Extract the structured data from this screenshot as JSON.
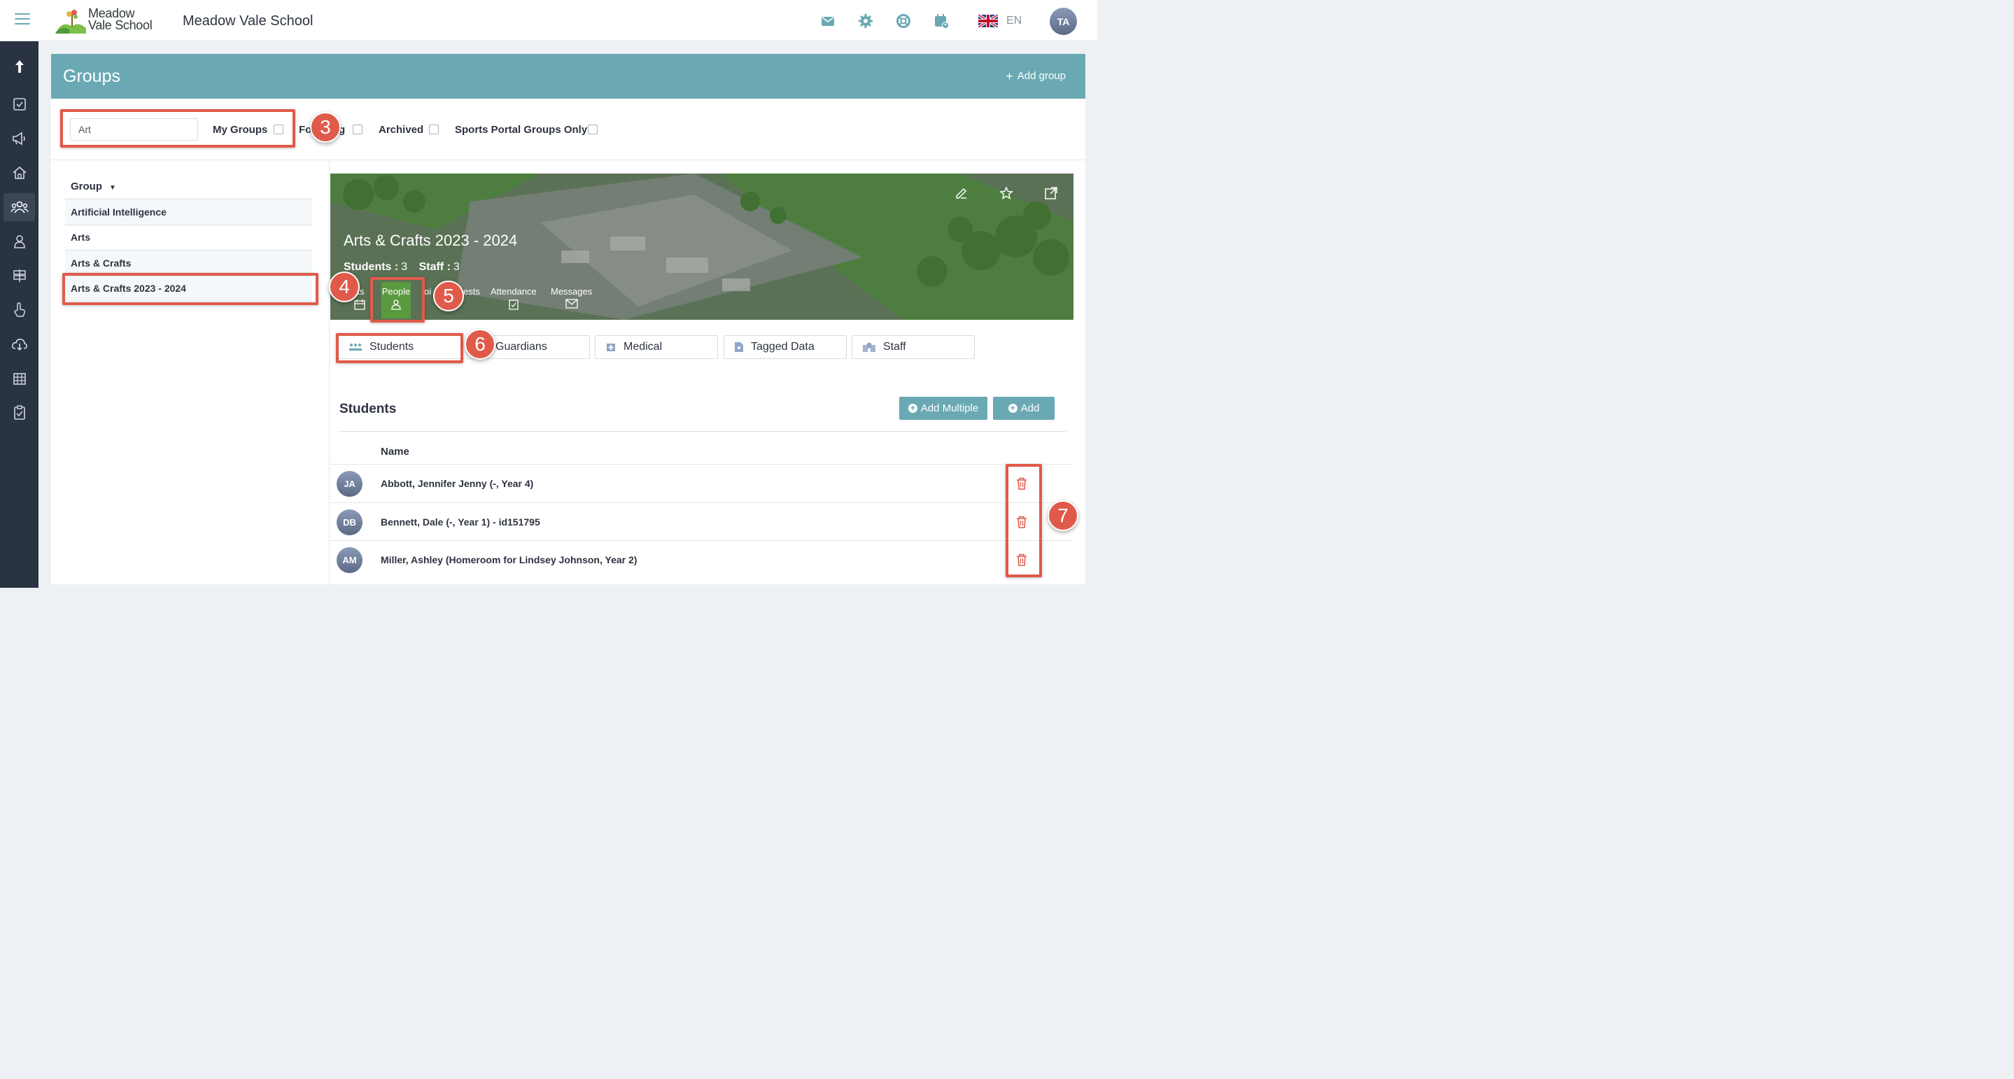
{
  "app": {
    "logo_text_line1": "Meadow",
    "logo_text_line2": "Vale School",
    "school_name": "Meadow Vale School",
    "language": "EN",
    "user_initials": "TA",
    "top_icons": [
      "mail-icon",
      "gear-icon",
      "lifebuoy-icon",
      "calendar-user-icon"
    ],
    "accent_color": "#6aa9b4",
    "sidebar_color": "#2a3342",
    "annotation_color": "#e05a4a"
  },
  "sidebar": {
    "items": [
      "arrow-up-icon",
      "checkbox-icon",
      "megaphone-icon",
      "home-icon",
      "groups-icon",
      "person-icon",
      "signpost-icon",
      "hand-pointer-icon",
      "cloud-download-icon",
      "calendar-grid-icon",
      "clipboard-check-icon"
    ],
    "active_index": 4
  },
  "header": {
    "title": "Groups",
    "add_group_label": "Add group"
  },
  "filters": {
    "search_value": "Art",
    "my_groups_label": "My Groups",
    "following_label_left": "Fo",
    "following_label_right": "g",
    "archived_label": "Archived",
    "sports_label": "Sports Portal Groups Only"
  },
  "group_list": {
    "header": "Group",
    "items": [
      "Artificial Intelligence",
      "Arts",
      "Arts & Crafts",
      "Arts & Crafts 2023 - 2024"
    ],
    "selected_index": 3
  },
  "banner": {
    "title": "Arts & Crafts 2023 - 2024",
    "students_label": "Students :",
    "students_count": "3",
    "staff_label": "Staff :",
    "staff_count": "3",
    "tabs": {
      "events_partial": "its",
      "people": "People",
      "points_partial": "oi",
      "interests_partial": "ests",
      "attendance": "Attendance",
      "messages": "Messages"
    }
  },
  "subtabs": [
    "Students",
    "Guardians",
    "Medical",
    "Tagged Data",
    "Staff"
  ],
  "students_section": {
    "title": "Students",
    "add_multiple_label": "Add Multiple",
    "add_label": "Add",
    "column_name": "Name",
    "rows": [
      {
        "initials": "JA",
        "name": "Abbott, Jennifer Jenny (-, Year 4)"
      },
      {
        "initials": "DB",
        "name": "Bennett, Dale (-, Year 1) - id151795"
      },
      {
        "initials": "AM",
        "name": "Miller, Ashley (Homeroom for Lindsey Johnson, Year 2)"
      }
    ]
  },
  "annotations": [
    "3",
    "4",
    "5",
    "6",
    "7"
  ]
}
